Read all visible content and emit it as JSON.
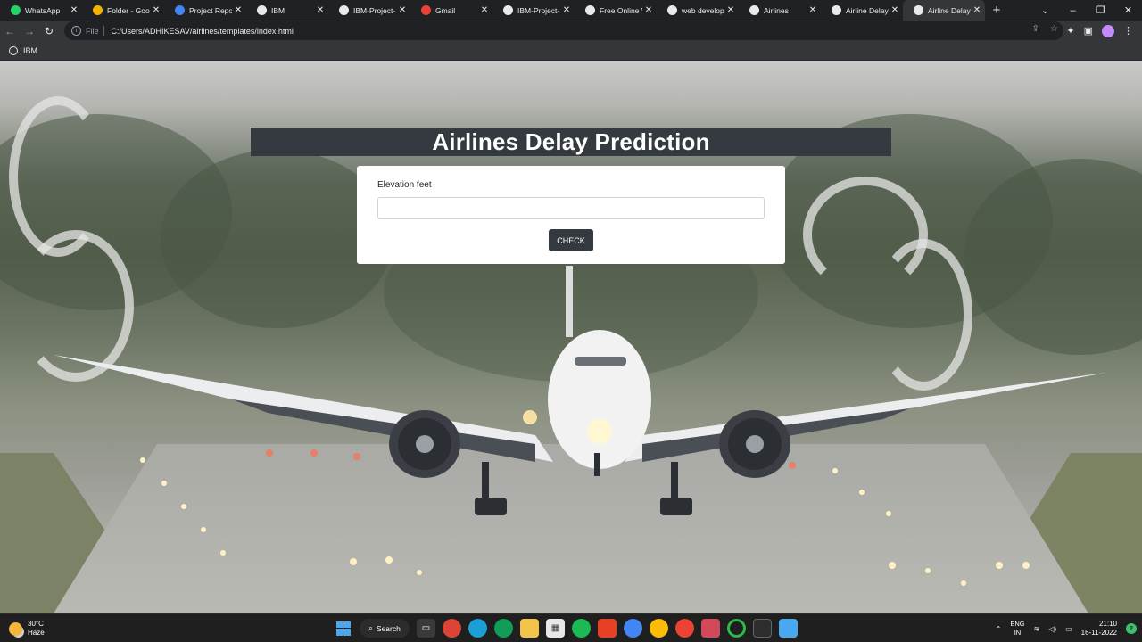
{
  "browser": {
    "tabs": [
      {
        "title": "WhatsApp",
        "icon": "whatsapp-icon",
        "color": "#25d366",
        "active": false
      },
      {
        "title": "Folder - Goog",
        "icon": "google-drive-icon",
        "color": "#f4b400",
        "active": false
      },
      {
        "title": "Project Repor",
        "icon": "google-docs-icon",
        "color": "#4285f4",
        "active": false
      },
      {
        "title": "IBM",
        "icon": "globe-icon",
        "color": "#e8eaed",
        "active": false
      },
      {
        "title": "IBM-Project-",
        "icon": "github-icon",
        "color": "#e8eaed",
        "active": false
      },
      {
        "title": "Gmail",
        "icon": "gmail-icon",
        "color": "#ea4335",
        "active": false
      },
      {
        "title": "IBM-Project-",
        "icon": "github-icon",
        "color": "#e8eaed",
        "active": false
      },
      {
        "title": "Free Online V",
        "icon": "v-icon",
        "color": "#e8eaed",
        "active": false
      },
      {
        "title": "web develope",
        "icon": "google-icon",
        "color": "#e8eaed",
        "active": false
      },
      {
        "title": "Airlines",
        "icon": "globe-icon",
        "color": "#e8eaed",
        "active": false
      },
      {
        "title": "Airline Delay",
        "icon": "globe-icon",
        "color": "#e8eaed",
        "active": false
      },
      {
        "title": "Airline Delay",
        "icon": "globe-icon",
        "color": "#e8eaed",
        "active": true
      }
    ],
    "new_tab_label": "+",
    "address": {
      "scheme_label": "File",
      "url": "C:/Users/ADHIKESAV/airlines/templates/index.html"
    },
    "bookmarks": [
      {
        "label": "IBM",
        "icon": "globe-icon"
      }
    ]
  },
  "page": {
    "title": "Airlines Delay Prediction",
    "form": {
      "field_label": "Elevation feet",
      "field_value": "",
      "field_placeholder": "",
      "submit_label": "CHECK"
    }
  },
  "taskbar": {
    "weather": {
      "temp": "30°C",
      "condition": "Haze"
    },
    "search_label": "Search",
    "language": {
      "line1": "ENG",
      "line2": "IN"
    },
    "time": "21:10",
    "date": "16-11-2022",
    "notification_count": "2"
  },
  "colors": {
    "title_bar": "#343a40",
    "button": "#343a40",
    "card": "#ffffff"
  }
}
